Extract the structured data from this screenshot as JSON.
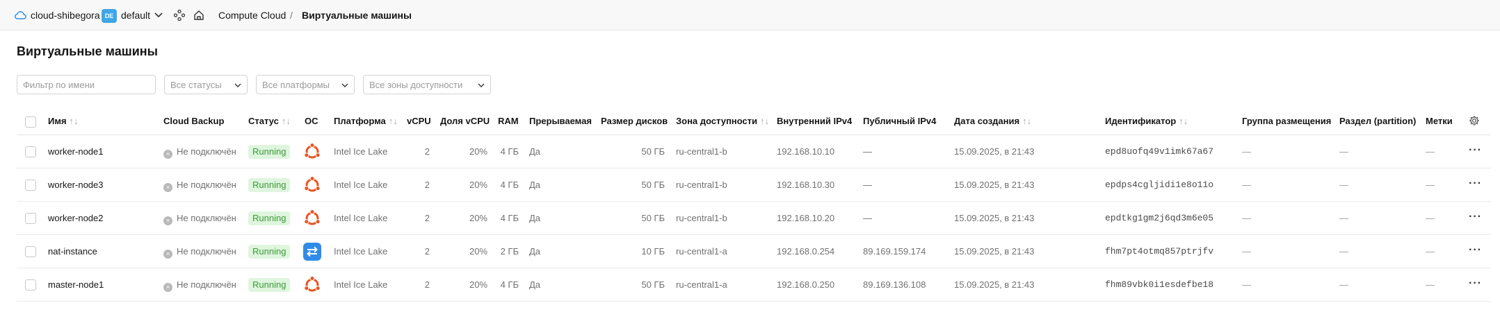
{
  "topbar": {
    "cloud": "cloud-shibegora",
    "folder_badge": "DE",
    "folder": "default",
    "breadcrumb_service": "Compute Cloud",
    "breadcrumb_separator": "/",
    "breadcrumb_current": "Виртуальные машины"
  },
  "page": {
    "title": "Виртуальные машины"
  },
  "filters": {
    "name_placeholder": "Фильтр по имени",
    "status": "Все статусы",
    "platform": "Все платформы",
    "zone": "Все зоны доступности"
  },
  "table": {
    "headers": {
      "name": "Имя",
      "backup": "Cloud Backup",
      "status": "Статус",
      "os": "ОС",
      "platform": "Платформа",
      "vcpu": "vCPU",
      "vcpu_share": "Доля vCPU",
      "ram": "RAM",
      "preemptible": "Прерываемая",
      "disk_size": "Размер дисков",
      "zone": "Зона доступности",
      "internal_ip": "Внутренний IPv4",
      "public_ip": "Публичный IPv4",
      "created": "Дата создания",
      "id": "Идентификатор",
      "placement": "Группа размещения",
      "partition": "Раздел (partition)",
      "labels": "Метки"
    },
    "rows": [
      {
        "name": "worker-node1",
        "backup": "Не подключён",
        "status": "Running",
        "os": "ubuntu-icon",
        "platform": "Intel Ice Lake",
        "vcpu": "2",
        "vcpu_share": "20%",
        "ram": "4 ГБ",
        "preemptible": "Да",
        "disk": "50 ГБ",
        "zone": "ru-central1-b",
        "internal_ip": "192.168.10.10",
        "public_ip": "—",
        "created": "15.09.2025, в 21:43",
        "id": "epd8uofq49v1imk67a67",
        "placement": "—",
        "partition": "—",
        "labels": "—"
      },
      {
        "name": "worker-node3",
        "backup": "Не подключён",
        "status": "Running",
        "os": "ubuntu-icon",
        "platform": "Intel Ice Lake",
        "vcpu": "2",
        "vcpu_share": "20%",
        "ram": "4 ГБ",
        "preemptible": "Да",
        "disk": "50 ГБ",
        "zone": "ru-central1-b",
        "internal_ip": "192.168.10.30",
        "public_ip": "—",
        "created": "15.09.2025, в 21:43",
        "id": "epdps4cgljidi1e8o11o",
        "placement": "—",
        "partition": "—",
        "labels": "—"
      },
      {
        "name": "worker-node2",
        "backup": "Не подключён",
        "status": "Running",
        "os": "ubuntu-icon",
        "platform": "Intel Ice Lake",
        "vcpu": "2",
        "vcpu_share": "20%",
        "ram": "4 ГБ",
        "preemptible": "Да",
        "disk": "50 ГБ",
        "zone": "ru-central1-b",
        "internal_ip": "192.168.10.20",
        "public_ip": "—",
        "created": "15.09.2025, в 21:43",
        "id": "epdtkg1gm2j6qd3m6e05",
        "placement": "—",
        "partition": "—",
        "labels": "—"
      },
      {
        "name": "nat-instance",
        "backup": "Не подключён",
        "status": "Running",
        "os": "nat-icon",
        "platform": "Intel Ice Lake",
        "vcpu": "2",
        "vcpu_share": "20%",
        "ram": "2 ГБ",
        "preemptible": "Да",
        "disk": "10 ГБ",
        "zone": "ru-central1-a",
        "internal_ip": "192.168.0.254",
        "public_ip": "89.169.159.174",
        "created": "15.09.2025, в 21:43",
        "id": "fhm7pt4otmq857ptrjfv",
        "placement": "—",
        "partition": "—",
        "labels": "—"
      },
      {
        "name": "master-node1",
        "backup": "Не подключён",
        "status": "Running",
        "os": "ubuntu-icon",
        "platform": "Intel Ice Lake",
        "vcpu": "2",
        "vcpu_share": "20%",
        "ram": "4 ГБ",
        "preemptible": "Да",
        "disk": "50 ГБ",
        "zone": "ru-central1-a",
        "internal_ip": "192.168.0.250",
        "public_ip": "89.169.136.108",
        "created": "15.09.2025, в 21:43",
        "id": "fhm89vbk0i1esdefbe18",
        "placement": "—",
        "partition": "—",
        "labels": "—"
      }
    ]
  },
  "colors": {
    "accent": "#3fa6e8",
    "running_bg": "#dff5de",
    "running_text": "#3a9b38",
    "ubuntu": "#e95420",
    "nat": "#2f8be8"
  }
}
